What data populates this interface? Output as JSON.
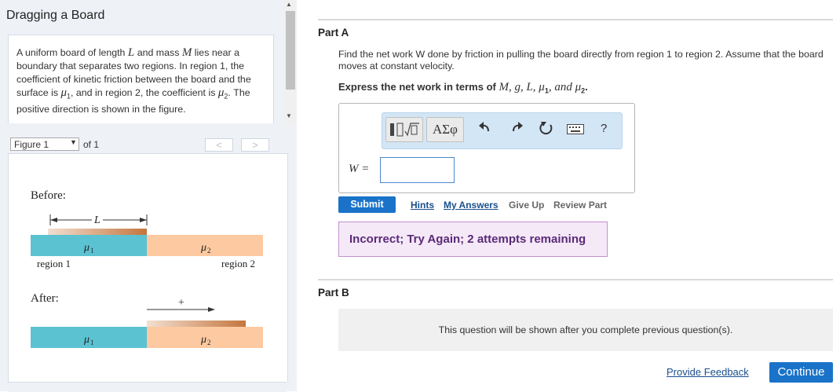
{
  "left": {
    "title": "Dragging a Board",
    "problem": {
      "t1": "A uniform board of length ",
      "L": "L",
      "t2": " and mass ",
      "M": "M",
      "t3": " lies near a boundary that separates two regions. In region 1, the coefficient of kinetic friction between the board and the surface is ",
      "mu1": "μ",
      "mu1_sub": "1",
      "t4": ", and in region 2, the coefficient is ",
      "mu2": "μ",
      "mu2_sub": "2",
      "t5": ". The positive direction is shown in the figure."
    },
    "figure_select": "Figure 1",
    "figure_of": "of 1",
    "prev": "<",
    "next": ">"
  },
  "figure": {
    "before_label": "Before:",
    "after_label": "After:",
    "length_label": "L",
    "mu1_label": "μ",
    "mu1_sub": "1",
    "mu2_label": "μ",
    "mu2_sub": "2",
    "region1_label": "region 1",
    "region2_label": "region 2",
    "plus_label": "+",
    "colors": {
      "region1": "#5bc2d2",
      "region2": "#fdc9a0",
      "board_light": "#f0d6c4",
      "board_dark": "#c4763e"
    }
  },
  "partA": {
    "label": "Part A",
    "question": "Find the net work W done by friction in pulling the board directly from region 1 to region 2. Assume that the board moves at constant velocity.",
    "express_prefix": "Express the net work in terms of ",
    "express_vars": "M, g, L, μ",
    "express_sub1": "1",
    "express_and": ", and μ",
    "express_sub2": "2",
    "express_end": ".",
    "toolbar": {
      "template_icon": "fraction-root-template-icon",
      "greek_label": "ΑΣφ",
      "undo_icon": "undo-icon",
      "redo_icon": "redo-icon",
      "reset_icon": "reset-icon",
      "keyboard_icon": "keyboard-icon",
      "help_label": "?"
    },
    "answer_label": "W =",
    "answer_value": "",
    "submit": "Submit",
    "links": {
      "hints": "Hints",
      "my_answers": "My Answers",
      "give_up": "Give Up",
      "review_part": "Review Part"
    },
    "feedback": "Incorrect; Try Again; 2 attempts remaining"
  },
  "partB": {
    "label": "Part B",
    "message": "This question will be shown after you complete previous question(s)."
  },
  "footer": {
    "provide_feedback": "Provide Feedback",
    "continue": "Continue"
  }
}
